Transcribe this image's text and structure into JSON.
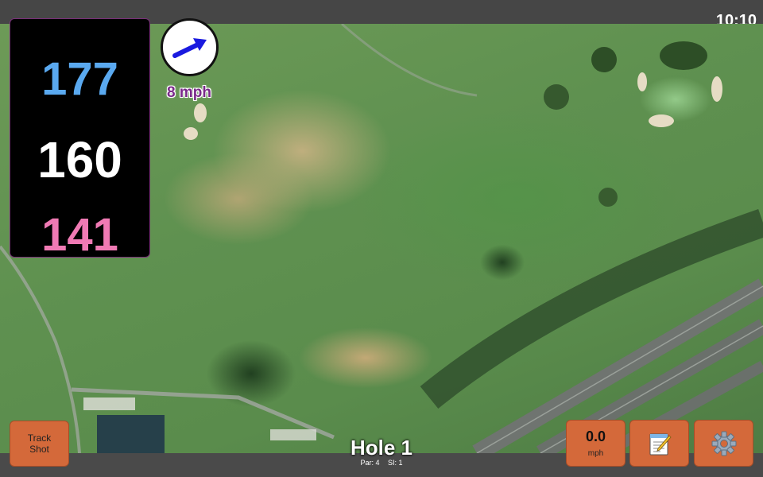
{
  "status_bar": {
    "time": "10:10"
  },
  "distances": {
    "back": "177",
    "middle": "160",
    "front": "141"
  },
  "wind": {
    "speed": "8 mph",
    "direction": "east-north-east",
    "arrow_color": "#1a1adf"
  },
  "hole": {
    "title": "Hole 1",
    "par": "Par: 4",
    "stroke_index": "SI: 1"
  },
  "buttons": {
    "track_shot": {
      "line1": "Track",
      "line2": "Shot"
    },
    "speed": {
      "value": "0.0",
      "unit": "mph"
    },
    "notes": {
      "icon": "notepad-icon"
    },
    "settings": {
      "icon": "gear-icon"
    }
  },
  "colors": {
    "button": "#d4693a",
    "back_distance": "#5aa9f0",
    "middle_distance": "#ffffff",
    "front_distance": "#f07ab4",
    "wind_label": "#7a2a8a"
  }
}
